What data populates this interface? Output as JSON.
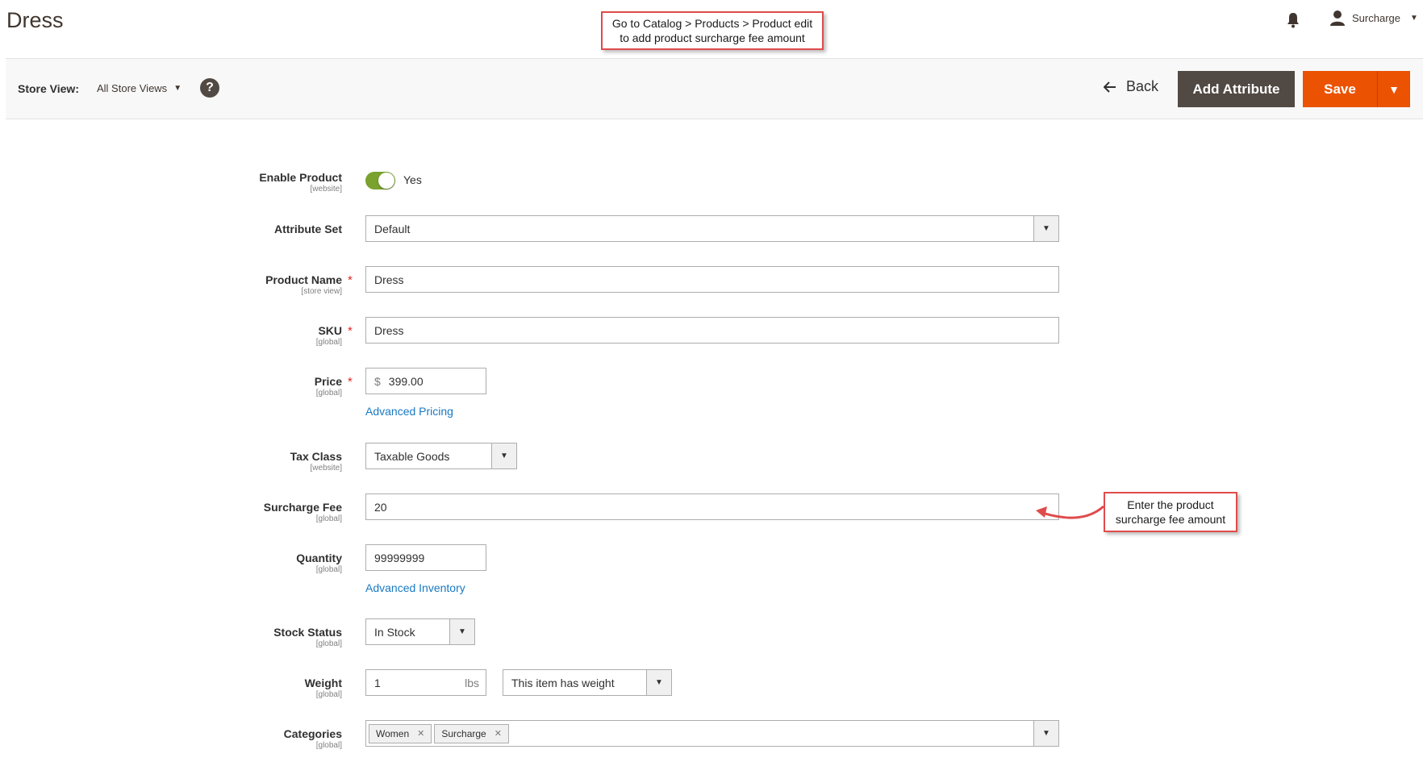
{
  "header": {
    "title": "Dress",
    "callout_top_line1": "Go to Catalog > Products > Product edit",
    "callout_top_line2": "to add product surcharge fee amount",
    "user_name": "Surcharge"
  },
  "action_bar": {
    "store_view_label": "Store View:",
    "store_view_value": "All Store Views",
    "help_label": "?",
    "back_label": "Back",
    "add_attribute_label": "Add Attribute",
    "save_label": "Save"
  },
  "form": {
    "enable_product": {
      "label": "Enable Product",
      "scope": "[website]",
      "value": "Yes",
      "enabled": true
    },
    "attribute_set": {
      "label": "Attribute Set",
      "value": "Default"
    },
    "product_name": {
      "label": "Product Name",
      "scope": "[store view]",
      "value": "Dress",
      "required": "*"
    },
    "sku": {
      "label": "SKU",
      "scope": "[global]",
      "value": "Dress",
      "required": "*"
    },
    "price": {
      "label": "Price",
      "scope": "[global]",
      "currency": "$",
      "value": "399.00",
      "required": "*",
      "link": "Advanced Pricing"
    },
    "tax_class": {
      "label": "Tax Class",
      "scope": "[website]",
      "value": "Taxable Goods"
    },
    "surcharge_fee": {
      "label": "Surcharge Fee",
      "scope": "[global]",
      "value": "20"
    },
    "quantity": {
      "label": "Quantity",
      "scope": "[global]",
      "value": "99999999",
      "link": "Advanced Inventory"
    },
    "stock_status": {
      "label": "Stock Status",
      "scope": "[global]",
      "value": "In Stock"
    },
    "weight": {
      "label": "Weight",
      "scope": "[global]",
      "value": "1",
      "unit": "lbs",
      "type_value": "This item has weight"
    },
    "categories": {
      "label": "Categories",
      "scope": "[global]",
      "tags": [
        "Women",
        "Surcharge"
      ]
    }
  },
  "callout_side": {
    "line1": "Enter the product",
    "line2": "surcharge fee amount"
  },
  "colors": {
    "accent": "#eb5202",
    "dark_button": "#514943",
    "toggle_on": "#79a22e",
    "link": "#1979c3",
    "callout_border": "#e04b4b"
  }
}
